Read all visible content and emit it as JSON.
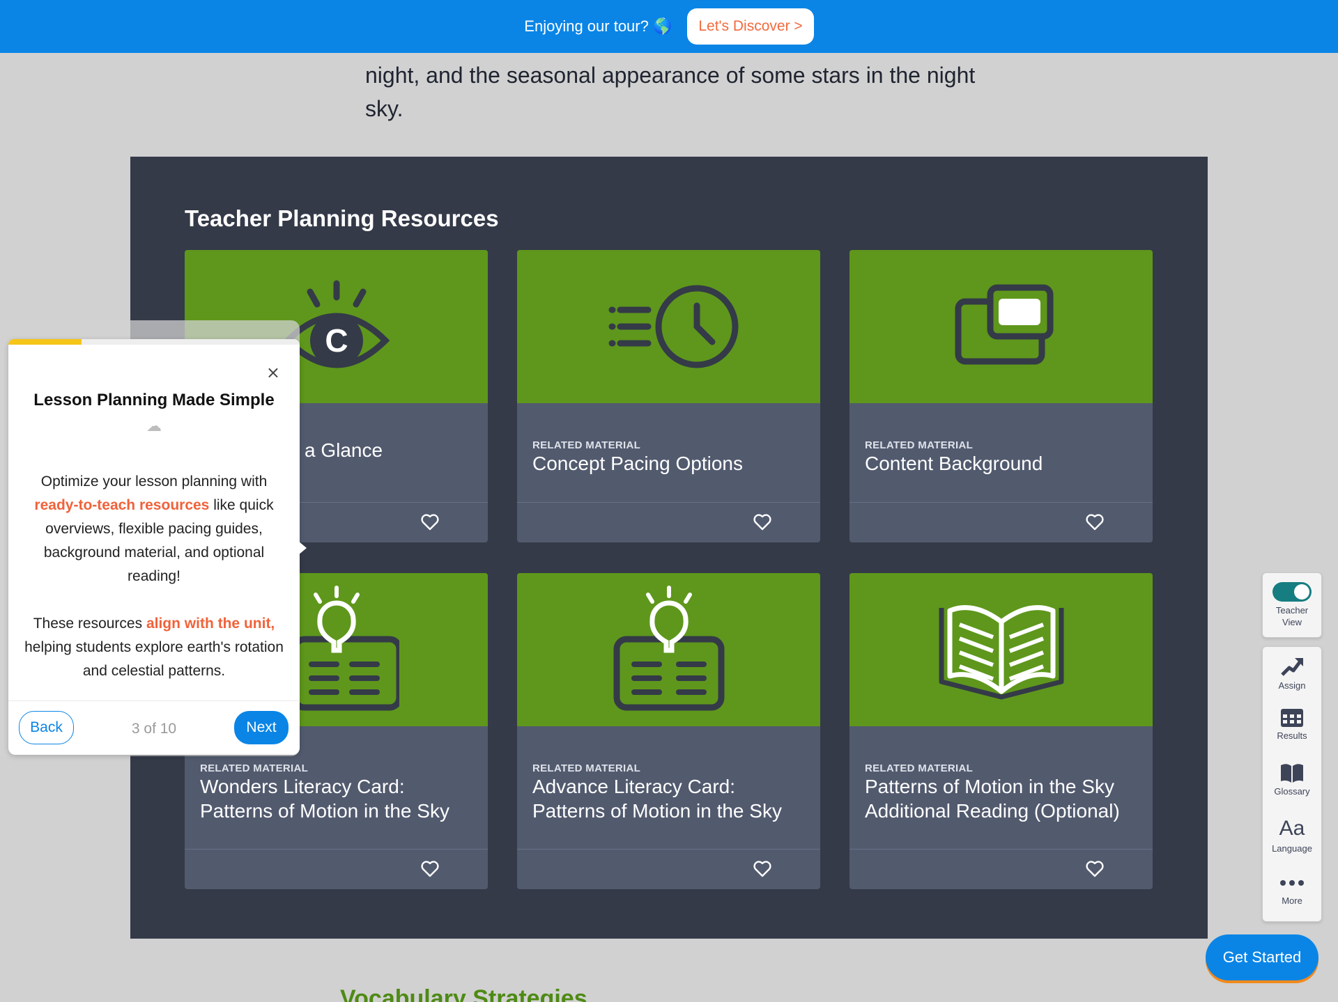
{
  "banner": {
    "text": "Enjoying our tour? 🌎",
    "button": "Let's Discover >"
  },
  "intro": {
    "text": "night, and the seasonal appearance of some stars in the night sky."
  },
  "panel": {
    "title": "Teacher Planning Resources",
    "cards": [
      {
        "kicker": "",
        "title": "a Glance",
        "icon": "eye-icon"
      },
      {
        "kicker": "RELATED MATERIAL",
        "title": "Concept Pacing Options",
        "icon": "clock-speed-icon"
      },
      {
        "kicker": "RELATED MATERIAL",
        "title": "Content Background",
        "icon": "windows-icon"
      },
      {
        "kicker": "RELATED MATERIAL",
        "title": "Wonders Literacy Card: Patterns of Motion in the Sky",
        "icon": "lightbulb-card-icon"
      },
      {
        "kicker": "RELATED MATERIAL",
        "title": "Advance Literacy Card: Patterns of Motion in the Sky",
        "icon": "lightbulb-card-icon"
      },
      {
        "kicker": "RELATED MATERIAL",
        "title": "Patterns of Motion in the Sky Additional Reading (Optional)",
        "icon": "open-book-icon"
      }
    ]
  },
  "toolbar": {
    "teacher_view": "Teacher View",
    "assign": "Assign",
    "results": "Results",
    "glossary": "Glossary",
    "language": "Language",
    "language_glyph": "Aa",
    "more": "More"
  },
  "get_started": "Get Started",
  "vocab_heading": "Vocabulary Strategies",
  "popup": {
    "title": "Lesson Planning Made Simple",
    "emoji": "☁",
    "para1_a": "Optimize your lesson planning with ",
    "para1_hl": "ready-to-teach resources",
    "para1_b": " like quick overviews, flexible pacing guides, background material, and optional reading!",
    "para2_a": "These resources ",
    "para2_hl": "align with the unit,",
    "para2_b": " helping students explore earth's rotation and celestial patterns.",
    "back": "Back",
    "step": "3 of 10",
    "next": "Next",
    "progress": 0.25,
    "close": "×"
  },
  "colors": {
    "accent": "#0a85e6",
    "card_green": "#5e971c",
    "highlight": "#f0623a",
    "progress": "#f5c518"
  }
}
